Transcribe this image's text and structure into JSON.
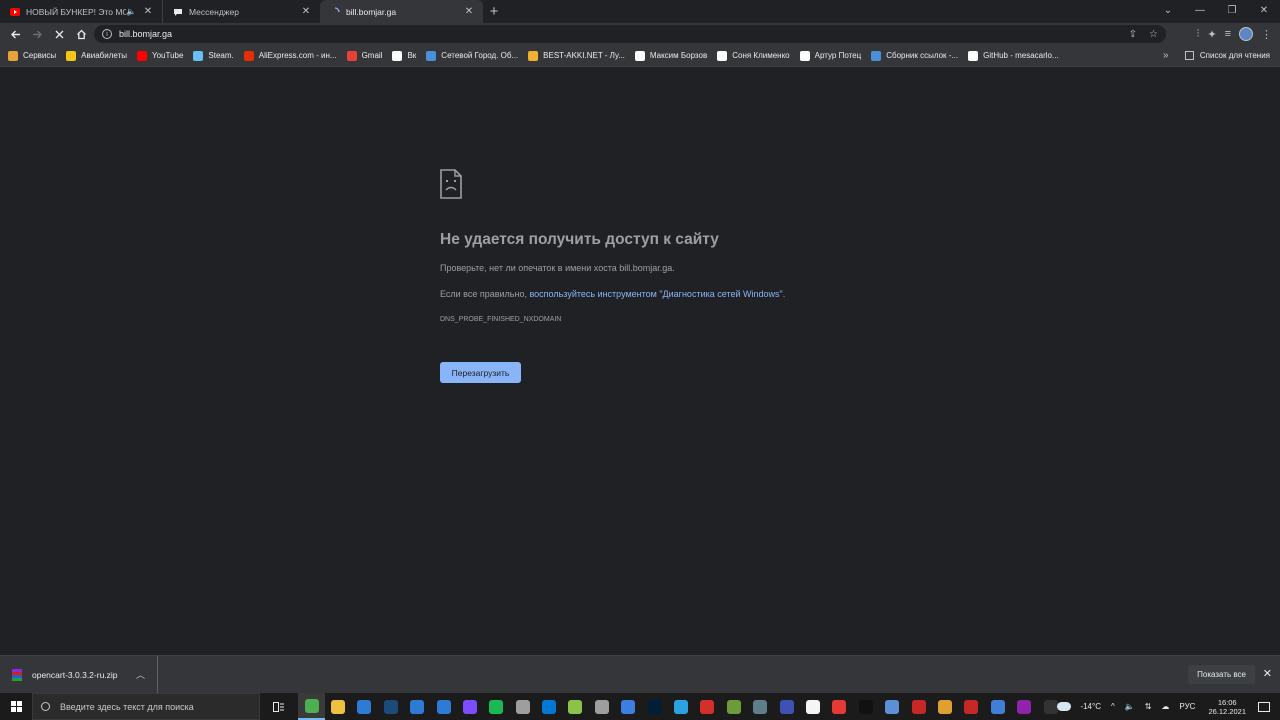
{
  "tabs": [
    {
      "title": "НОВЫЙ БУНКЕР! Это МОЁ - ",
      "favicon": "youtube-icon",
      "audio": true
    },
    {
      "title": "Мессенджер",
      "favicon": "messenger-icon",
      "audio": false
    },
    {
      "title": "bill.bomjar.ga",
      "favicon": "loading-icon",
      "audio": false,
      "active": true
    }
  ],
  "toolbar": {
    "url": "bill.bomjar.ga"
  },
  "bookmarks": [
    {
      "label": "Сервисы",
      "icon": "apps-grid-icon",
      "color": "#e8a33d"
    },
    {
      "label": "Авиабилеты",
      "icon": "plane-icon",
      "color": "#f5c518"
    },
    {
      "label": "YouTube",
      "icon": "youtube-icon",
      "color": "#ff0000"
    },
    {
      "label": "Steam.",
      "icon": "steam-icon",
      "color": "#66c0f4"
    },
    {
      "label": "AliExpress.com - ин...",
      "icon": "aliexpress-icon",
      "color": "#e62e04"
    },
    {
      "label": "Gmail",
      "icon": "gmail-icon",
      "color": "#ea4335"
    },
    {
      "label": "Вк",
      "icon": "pause-icon",
      "color": "#ffffff"
    },
    {
      "label": "Сетевой Город. Об...",
      "icon": "school-icon",
      "color": "#4a90d9"
    },
    {
      "label": "BEST-AKKI.NET - Лу...",
      "icon": "best-akki-icon",
      "color": "#f0b030"
    },
    {
      "label": "Максим Борзов",
      "icon": "vk-icon",
      "color": "#ffffff"
    },
    {
      "label": "Соня Клименко",
      "icon": "vk-icon",
      "color": "#ffffff"
    },
    {
      "label": "Артур Потец",
      "icon": "vk-icon",
      "color": "#ffffff"
    },
    {
      "label": "Сборник ссылок -...",
      "icon": "link-collection-icon",
      "color": "#4a90d9"
    },
    {
      "label": "GitHub - mesacarlo...",
      "icon": "github-icon",
      "color": "#ffffff"
    }
  ],
  "reading_list_label": "Список для чтения",
  "more_bookmarks": "»",
  "error": {
    "title": "Не удается получить доступ к сайту",
    "line1": "Проверьте, нет ли опечаток в имени хоста bill.bomjar.ga.",
    "line2_prefix": "Если все правильно, ",
    "line2_link": "воспользуйтесь инструментом \"Диагностика сетей Windows\"",
    "line2_suffix": ".",
    "code": "DNS_PROBE_FINISHED_NXDOMAIN",
    "reload_label": "Перезагрузить"
  },
  "download": {
    "filename": "opencart-3.0.3.2-ru.zip",
    "show_all_label": "Показать все"
  },
  "taskbar": {
    "search_placeholder": "Введите здесь текст для поиска",
    "temperature": "-14°C",
    "language": "РУС",
    "time": "16:06",
    "date": "26.12.2021"
  },
  "taskbar_apps": [
    {
      "name": "chrome-icon",
      "color": "#4caf50",
      "active": true
    },
    {
      "name": "file-explorer-icon",
      "color": "#f0c040"
    },
    {
      "name": "store-icon",
      "color": "#2e7bd6"
    },
    {
      "name": "steam-icon",
      "color": "#1b4b7a"
    },
    {
      "name": "window-app-icon",
      "color": "#2e7bd6"
    },
    {
      "name": "mail-icon",
      "color": "#2e7bd6"
    },
    {
      "name": "chrome-dev-icon",
      "color": "#7c4dff"
    },
    {
      "name": "spotify-icon",
      "color": "#1db954"
    },
    {
      "name": "disk-icon",
      "color": "#9e9e9e"
    },
    {
      "name": "vscode-icon",
      "color": "#0078d4"
    },
    {
      "name": "notepad-plus-icon",
      "color": "#8bc34a"
    },
    {
      "name": "cube-app-icon",
      "color": "#9e9e9e"
    },
    {
      "name": "qbittorrent-icon",
      "color": "#3d7fe0"
    },
    {
      "name": "photoshop-icon",
      "color": "#001e36"
    },
    {
      "name": "telegram-icon",
      "color": "#2aa3e0"
    },
    {
      "name": "wps-icon",
      "color": "#d32f2f"
    },
    {
      "name": "minecraft-icon",
      "color": "#6d9b3a"
    },
    {
      "name": "image-viewer-icon",
      "color": "#607d8b"
    },
    {
      "name": "network-app-icon",
      "color": "#3f51b5"
    },
    {
      "name": "document-icon",
      "color": "#f5f5f5"
    },
    {
      "name": "record-icon",
      "color": "#e53935"
    },
    {
      "name": "tiktok-icon",
      "color": "#111111"
    },
    {
      "name": "edit-app-icon",
      "color": "#5c8fd6"
    },
    {
      "name": "game-launcher-icon",
      "color": "#c62828"
    },
    {
      "name": "orange-app-icon",
      "color": "#e0a030"
    },
    {
      "name": "filezilla-icon",
      "color": "#c62828"
    },
    {
      "name": "browser-alt-icon",
      "color": "#3f7fd6"
    },
    {
      "name": "winrar-icon",
      "color": "#8e24aa"
    },
    {
      "name": "terminal-icon",
      "color": "#333333"
    }
  ]
}
